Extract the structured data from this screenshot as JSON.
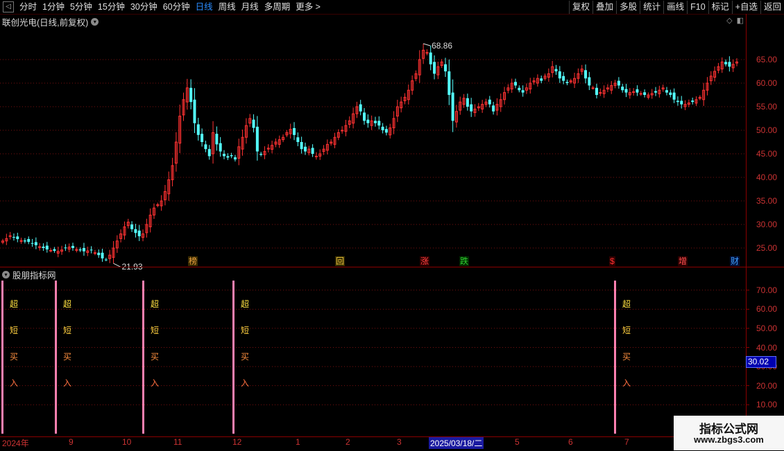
{
  "toolbar": {
    "back_glyph": "◁",
    "periods": [
      "分时",
      "1分钟",
      "5分钟",
      "15分钟",
      "30分钟",
      "60分钟",
      "日线",
      "周线",
      "月线",
      "多周期",
      "更多 >"
    ],
    "active_period": "日线",
    "right_buttons": [
      "复权",
      "叠加",
      "多股",
      "统计",
      "画线",
      "F10",
      "标记",
      "+自选",
      "返回"
    ]
  },
  "stock": {
    "title": "联创光电(日线,前复权)"
  },
  "top_icons": {
    "diamond": "◇",
    "split": "◧"
  },
  "indicator": {
    "title": "股朋指标网"
  },
  "price_axis": [
    "65.00",
    "60.00",
    "55.00",
    "50.00",
    "45.00",
    "40.00",
    "35.00",
    "30.00",
    "25.00"
  ],
  "ind_axis": [
    "70.00",
    "60.00",
    "50.00",
    "40.00",
    "30.00",
    "20.00",
    "10.00"
  ],
  "current_value": "30.02",
  "price_marks": {
    "high": "68.86",
    "low": "21.93"
  },
  "events": [
    {
      "label": "榜",
      "color": "#e8a040",
      "bg": "#3a2a00"
    },
    {
      "label": "回",
      "color": "#e8c040",
      "bg": "#3a3000"
    },
    {
      "label": "涨",
      "color": "#ff4040",
      "bg": "#300000"
    },
    {
      "label": "跌",
      "color": "#30d030",
      "bg": "#002a00"
    },
    {
      "label": "$",
      "color": "#ff3030",
      "bg": "#300000"
    },
    {
      "label": "增",
      "color": "#ff5050",
      "bg": "#300000"
    },
    {
      "label": "财",
      "color": "#40a0ff",
      "bg": "#00103a"
    }
  ],
  "signal_chars": [
    "超",
    "短",
    "买",
    "入"
  ],
  "signal_colors": [
    "#ffe040",
    "#ffd040",
    "#ff9040",
    "#ff7040"
  ],
  "dates": [
    "2024年",
    "9",
    "10",
    "11",
    "12",
    "1",
    "2",
    "3",
    "2025/03/18/二",
    "5",
    "6",
    "7"
  ],
  "watermark": {
    "line1": "指标公式网",
    "line2": "www.zbgs3.com"
  },
  "chart_data": {
    "type": "candlestick",
    "ylim": [
      20,
      70
    ],
    "indicator_ylim": [
      5,
      75
    ],
    "up_color": "#ff3232",
    "down_color": "#54ffff",
    "closes": [
      26.5,
      27.0,
      27.6,
      27.2,
      26.9,
      26.6,
      26.4,
      26.3,
      26.0,
      25.6,
      25.3,
      25.0,
      24.7,
      24.5,
      24.4,
      24.3,
      24.6,
      25.0,
      25.2,
      25.0,
      24.7,
      24.5,
      24.3,
      24.4,
      24.5,
      24.0,
      23.5,
      22.8,
      22.5,
      23.5,
      25.0,
      26.5,
      28.0,
      29.5,
      30.5,
      29.0,
      28.2,
      27.5,
      28.0,
      30.0,
      32.0,
      33.5,
      34.2,
      35.0,
      37.0,
      39.5,
      42.5,
      47.5,
      53.0,
      56.5,
      59.0,
      56.0,
      51.5,
      49.0,
      47.5,
      46.0,
      44.5,
      49.5,
      47.0,
      45.5,
      44.5,
      44.2,
      44.5,
      43.8,
      46.5,
      48.5,
      51.0,
      52.5,
      50.5,
      45.5,
      44.8,
      45.5,
      46.2,
      46.8,
      47.5,
      48.0,
      48.5,
      49.5,
      50.2,
      49.0,
      47.5,
      46.0,
      45.5,
      46.0,
      45.0,
      44.5,
      45.0,
      46.0,
      47.0,
      47.5,
      48.5,
      49.5,
      50.0,
      51.0,
      52.0,
      53.5,
      55.0,
      54.0,
      52.0,
      51.5,
      52.0,
      51.5,
      51.0,
      50.0,
      49.5,
      50.5,
      52.5,
      55.0,
      56.0,
      57.0,
      58.5,
      60.5,
      62.0,
      65.0,
      67.0,
      66.5,
      64.0,
      62.0,
      63.5,
      64.5,
      62.5,
      57.5,
      52.0,
      54.0,
      56.0,
      56.8,
      55.0,
      54.0,
      54.5,
      55.0,
      55.5,
      56.0,
      55.5,
      54.0,
      55.5,
      56.5,
      58.0,
      59.0,
      60.0,
      59.5,
      58.5,
      58.0,
      59.0,
      60.0,
      60.5,
      61.0,
      60.5,
      61.5,
      62.0,
      63.5,
      62.5,
      61.0,
      60.5,
      60.0,
      60.5,
      61.0,
      62.0,
      63.0,
      61.0,
      59.5,
      59.0,
      57.5,
      58.0,
      58.5,
      59.0,
      59.5,
      60.0,
      59.5,
      58.5,
      58.0,
      58.0,
      58.2,
      58.0,
      57.8,
      57.5,
      57.5,
      57.8,
      58.0,
      58.5,
      59.0,
      58.0,
      57.5,
      56.5,
      56.0,
      55.5,
      55.5,
      55.8,
      56.0,
      56.5,
      57.0,
      58.5,
      60.0,
      61.5,
      62.5,
      63.5,
      64.5,
      64.0,
      63.5,
      64.0,
      64.5
    ],
    "high_label": 68.86,
    "low_label": 21.93,
    "signals": [
      {
        "x_frac": 0.0,
        "label": "超短买入"
      },
      {
        "x_frac": 0.074,
        "label": "超短买入"
      },
      {
        "x_frac": 0.19,
        "label": "超短买入"
      },
      {
        "x_frac": 0.311,
        "label": "超短买入"
      },
      {
        "x_frac": 0.824,
        "label": "超短买入"
      }
    ]
  }
}
